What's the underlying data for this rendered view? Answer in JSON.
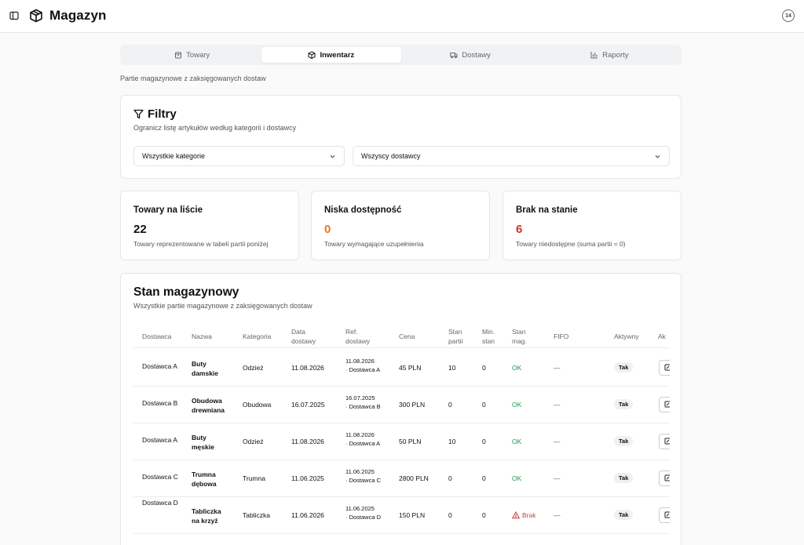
{
  "header": {
    "title": "Magazyn",
    "notifications": "14"
  },
  "tabs": [
    {
      "label": "Towary",
      "icon": "package-icon"
    },
    {
      "label": "Inwentarz",
      "icon": "box-icon",
      "active": true
    },
    {
      "label": "Dostawy",
      "icon": "truck-icon"
    },
    {
      "label": "Raporty",
      "icon": "bar-chart-icon"
    }
  ],
  "page_subtitle": "Partie magazynowe z zaksięgowanych dostaw",
  "filters": {
    "title": "Filtry",
    "description": "Ogranicz listę artykułów według kategorii i dostawcy",
    "category_select": "Wszystkie kategorie",
    "supplier_select": "Wszyscy dostawcy"
  },
  "stats": [
    {
      "title": "Towary na liście",
      "value": "22",
      "description": "Towary reprezentowane w tabeli partii poniżej",
      "color": "#111111"
    },
    {
      "title": "Niska dostępność",
      "value": "0",
      "description": "Towary wymagające uzupełnienia",
      "color": "#e07b24"
    },
    {
      "title": "Brak na stanie",
      "value": "6",
      "description": "Towary niedostępne (suma partii = 0)",
      "color": "#c23a2b"
    }
  ],
  "stock": {
    "title": "Stan magazynowy",
    "description": "Wszystkie partie magazynowe z zaksięgowanych dostaw",
    "columns": [
      {
        "l1": "Dostawca",
        "l2": ""
      },
      {
        "l1": "Nazwa",
        "l2": ""
      },
      {
        "l1": "Kategoria",
        "l2": ""
      },
      {
        "l1": "Data",
        "l2": "dostawy"
      },
      {
        "l1": "Ref.",
        "l2": "dostawy"
      },
      {
        "l1": "Cena",
        "l2": ""
      },
      {
        "l1": "Stan",
        "l2": "partii"
      },
      {
        "l1": "Min.",
        "l2": "stan"
      },
      {
        "l1": "Stan",
        "l2": "mag."
      },
      {
        "l1": "FIFO",
        "l2": ""
      },
      {
        "l1": "Aktywny",
        "l2": ""
      },
      {
        "l1": "Ak",
        "l2": ""
      }
    ],
    "rows": [
      {
        "supplier": "Dostawca A",
        "name1": "Buty",
        "name2": "damskie",
        "category": "Odzież",
        "date": "11.08.2026",
        "ref1": "11.08.2026",
        "ref2": "· Dostawca A",
        "price": "45 PLN",
        "batch": "10",
        "min": "0",
        "status": "OK",
        "fifo": "—",
        "active": "Tak"
      },
      {
        "supplier": "Dostawca B",
        "name1": "Obudowa",
        "name2": "drewniana",
        "category": "Obudowa",
        "date": "16.07.2025",
        "ref1": "16.07.2025",
        "ref2": "· Dostawca B",
        "price": "300 PLN",
        "batch": "0",
        "min": "0",
        "status": "OK",
        "fifo": "—",
        "active": "Tak"
      },
      {
        "supplier": "Dostawca A",
        "name1": "Buty",
        "name2": "męskie",
        "category": "Odzież",
        "date": "11.08.2026",
        "ref1": "11.08.2026",
        "ref2": "· Dostawca A",
        "price": "50 PLN",
        "batch": "10",
        "min": "0",
        "status": "OK",
        "fifo": "—",
        "active": "Tak"
      },
      {
        "supplier": "Dostawca C",
        "name1": "Trumna",
        "name2": "dębowa",
        "category": "Trumna",
        "date": "11.06.2025",
        "ref1": "11.06.2025",
        "ref2": "· Dostawca C",
        "price": "2800 PLN",
        "batch": "0",
        "min": "0",
        "status": "OK",
        "fifo": "—",
        "active": "Tak"
      },
      {
        "supplier": "Dostawca D",
        "name1": "Tabliczka",
        "name2": "na krzyż",
        "category": "Tabliczka",
        "date": "11.06.2026",
        "ref1": "11.06.2025",
        "ref2": "· Dostawca D",
        "price": "150 PLN",
        "batch": "0",
        "min": "0",
        "status": "Brak",
        "fifo": "—",
        "active": "Tak"
      }
    ]
  },
  "colors": {
    "ok": "#1a9a4b",
    "brak": "#d33b3b"
  }
}
